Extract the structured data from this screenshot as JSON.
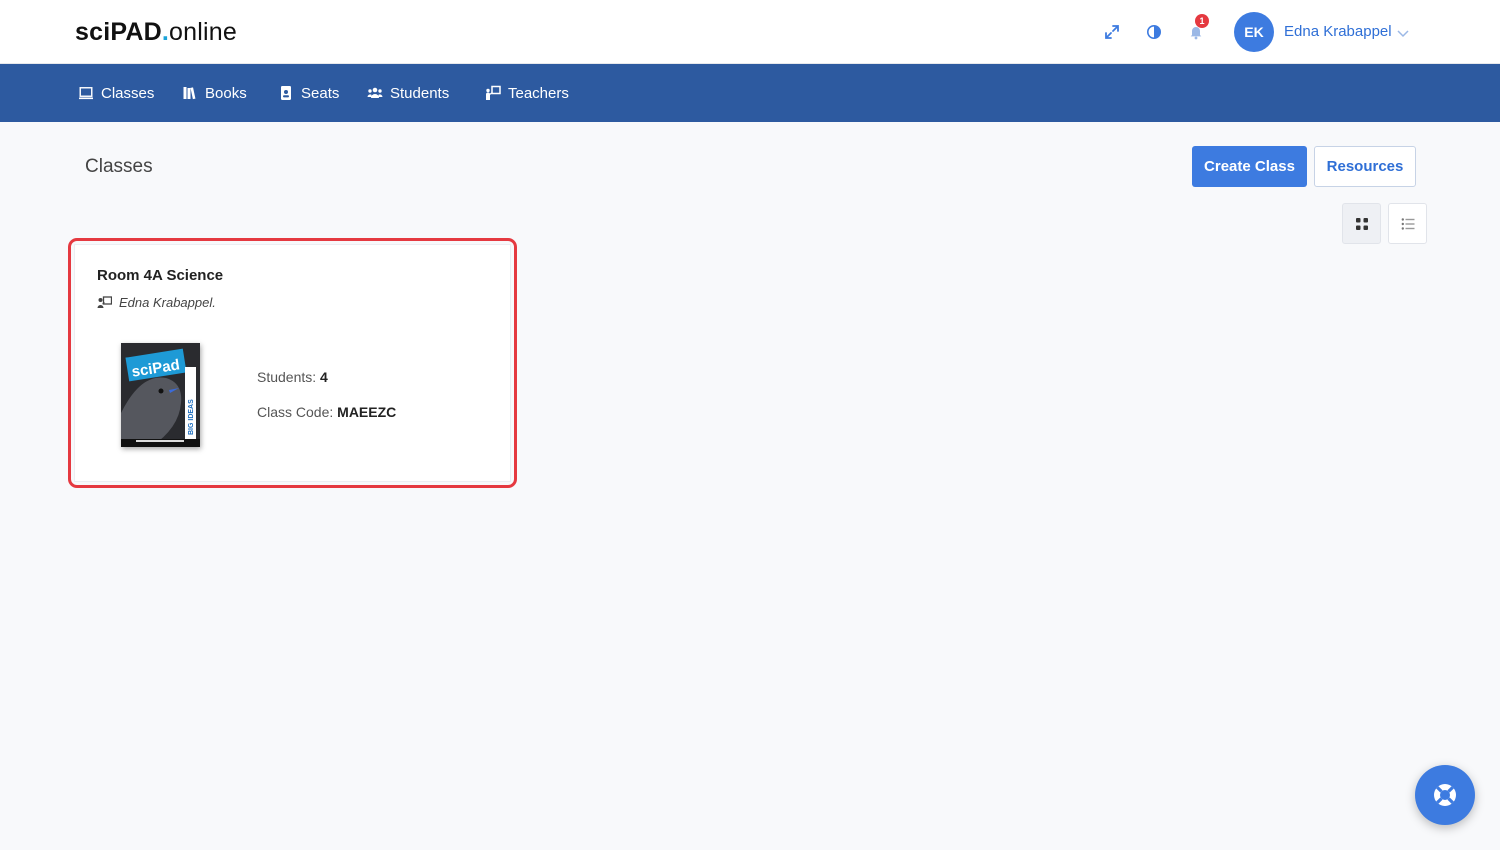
{
  "header": {
    "logo": {
      "part1": "sciPAD",
      "dot": ".",
      "part2": "online"
    },
    "notification_count": "1",
    "user": {
      "initials": "EK",
      "name": "Edna Krabappel"
    }
  },
  "nav": {
    "items": [
      {
        "label": "Classes",
        "icon": "classroom-icon"
      },
      {
        "label": "Books",
        "icon": "books-icon"
      },
      {
        "label": "Seats",
        "icon": "seat-badge-icon"
      },
      {
        "label": "Students",
        "icon": "students-icon"
      },
      {
        "label": "Teachers",
        "icon": "teacher-board-icon"
      }
    ]
  },
  "page": {
    "title": "Classes",
    "create_label": "Create Class",
    "resources_label": "Resources"
  },
  "classes": [
    {
      "name": "Room 4A Science",
      "teacher": "Edna Krabappel.",
      "book_cover_text": "sciPad",
      "book_spine_text": "BIG IDEAS",
      "students_label": "Students:",
      "students_value": "4",
      "code_label": "Class Code:",
      "code_value": "MAEEZC"
    }
  ],
  "colors": {
    "primary": "#3d7be0",
    "nav_bg": "#2d5aa0",
    "highlight": "#e53940",
    "logo_dot": "#1aa3d9"
  }
}
